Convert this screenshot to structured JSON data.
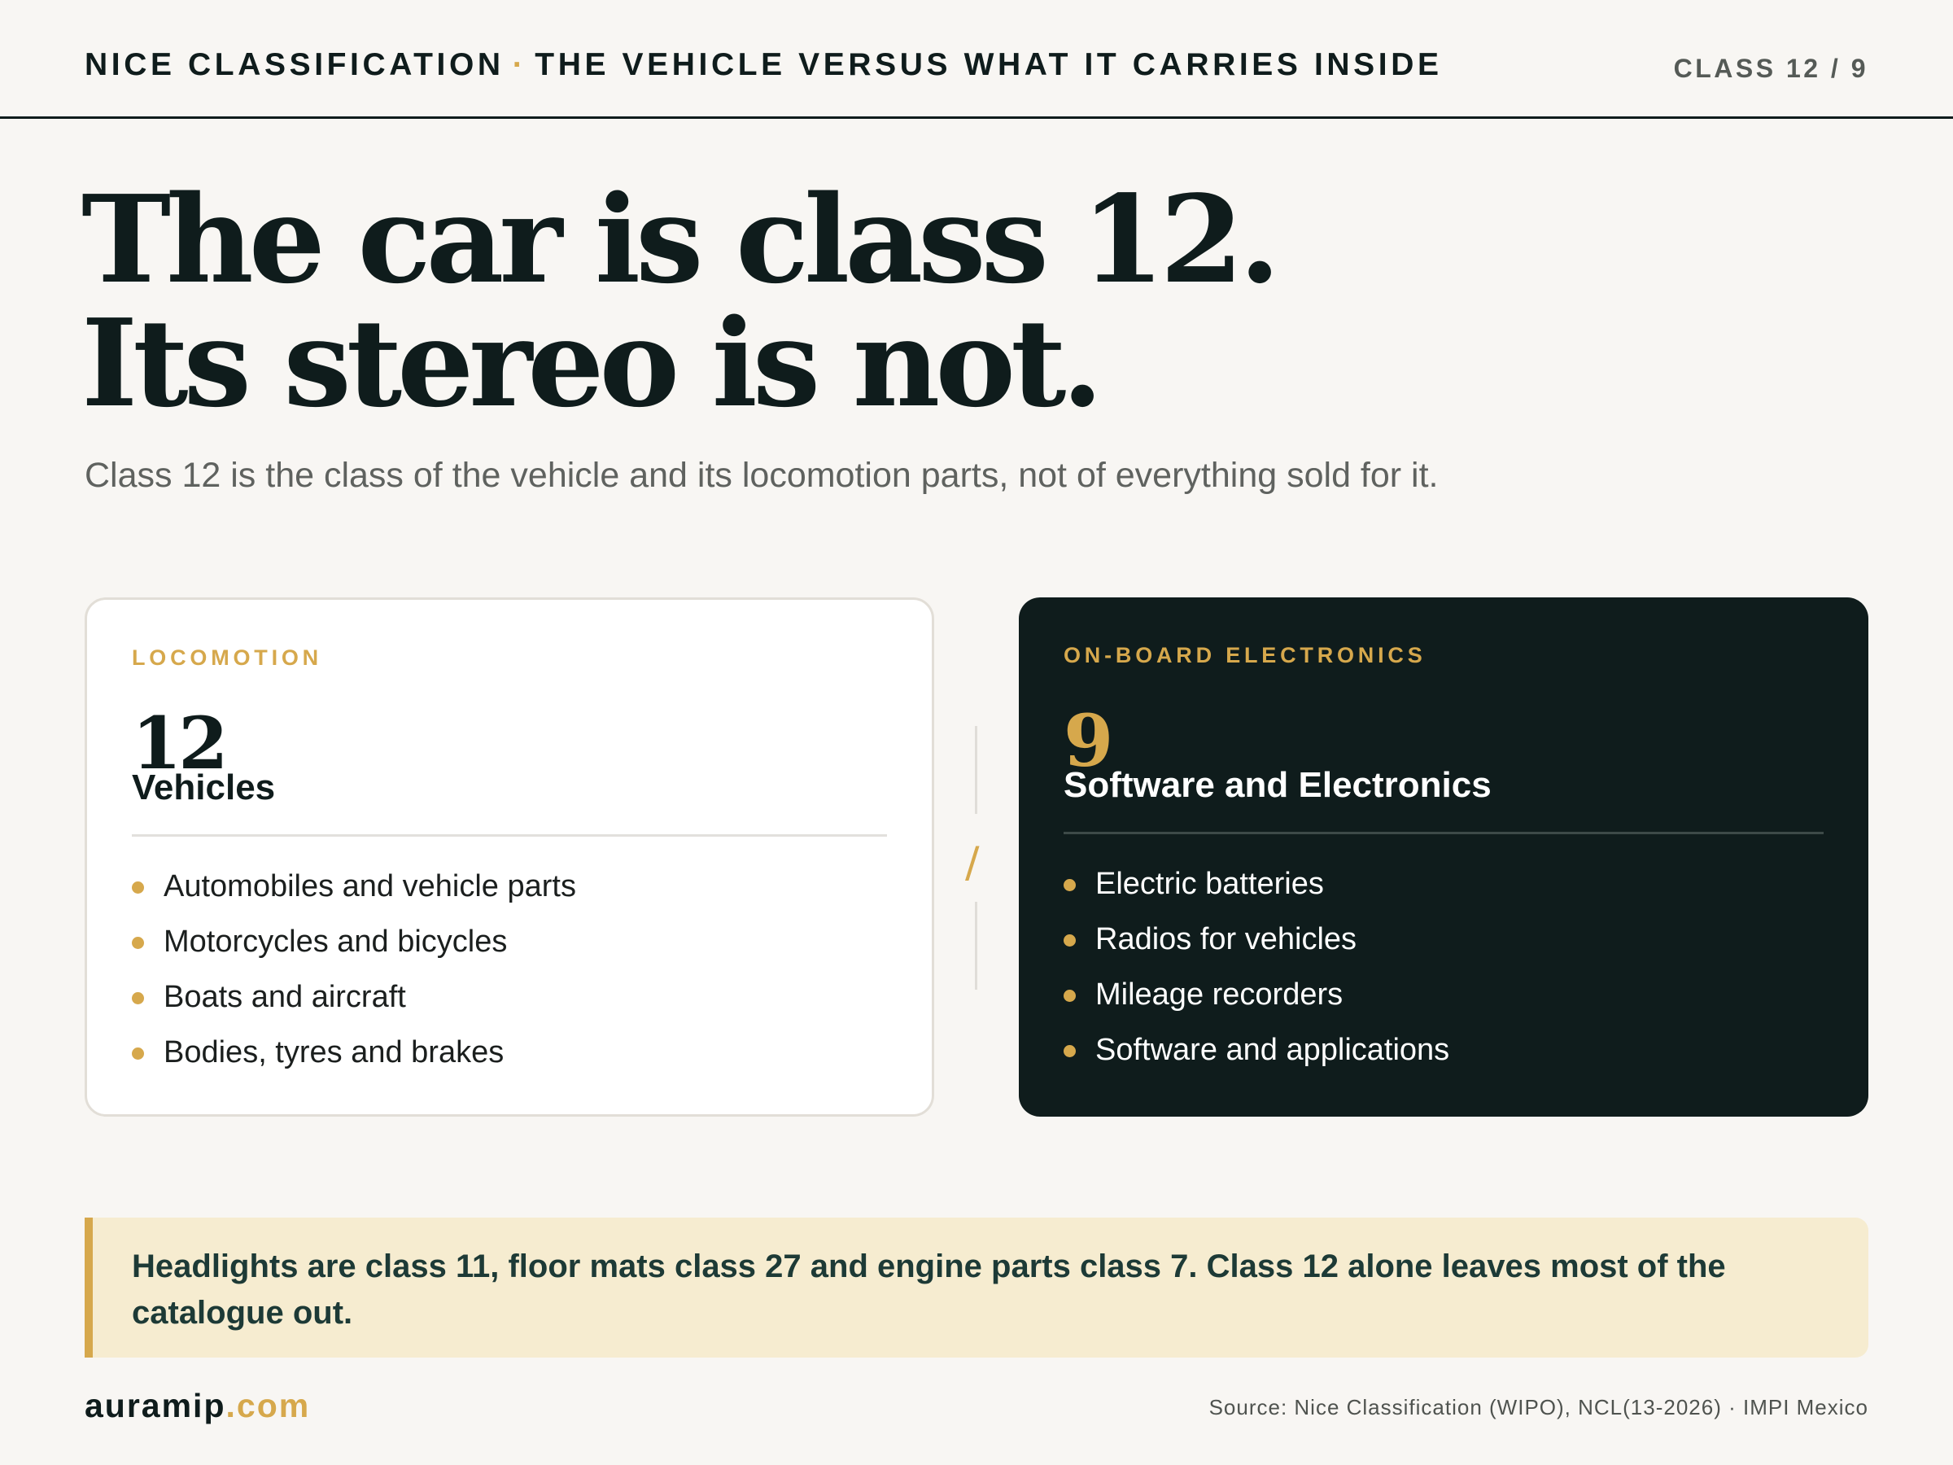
{
  "header": {
    "title_left": "NICE CLASSIFICATION",
    "separator": "·",
    "title_right": "THE VEHICLE VERSUS WHAT IT CARRIES INSIDE",
    "pager": "CLASS 12 / 9"
  },
  "hero": {
    "line1": "The car is class 12.",
    "line2": "Its stereo is not.",
    "subtitle": "Class 12 is the class of the vehicle and its locomotion parts, not of everything sold for it."
  },
  "left_card": {
    "label": "LOCOMOTION",
    "number": "12",
    "name": "Vehicles",
    "items": [
      "Automobiles and vehicle parts",
      "Motorcycles and bicycles",
      "Boats and aircraft",
      "Bodies, tyres and brakes"
    ]
  },
  "divider": {
    "symbol": "/"
  },
  "right_card": {
    "label": "ON-BOARD ELECTRONICS",
    "number": "9",
    "name": "Software and Electronics",
    "items": [
      "Electric batteries",
      "Radios for vehicles",
      "Mileage recorders",
      "Software and applications"
    ]
  },
  "callout": {
    "text": "Headlights are class 11, floor mats class 27 and engine parts class 7. Class 12 alone leaves most of the catalogue out."
  },
  "footer": {
    "brand_name": "auramip",
    "brand_tld": ".com",
    "source": "Source: Nice Classification (WIPO), NCL(13-2026) · IMPI Mexico"
  },
  "colors": {
    "ink": "#0f1c1c",
    "accent": "#d6a84c",
    "background": "#f8f6f3",
    "callout_bg": "#f6ecd0"
  }
}
